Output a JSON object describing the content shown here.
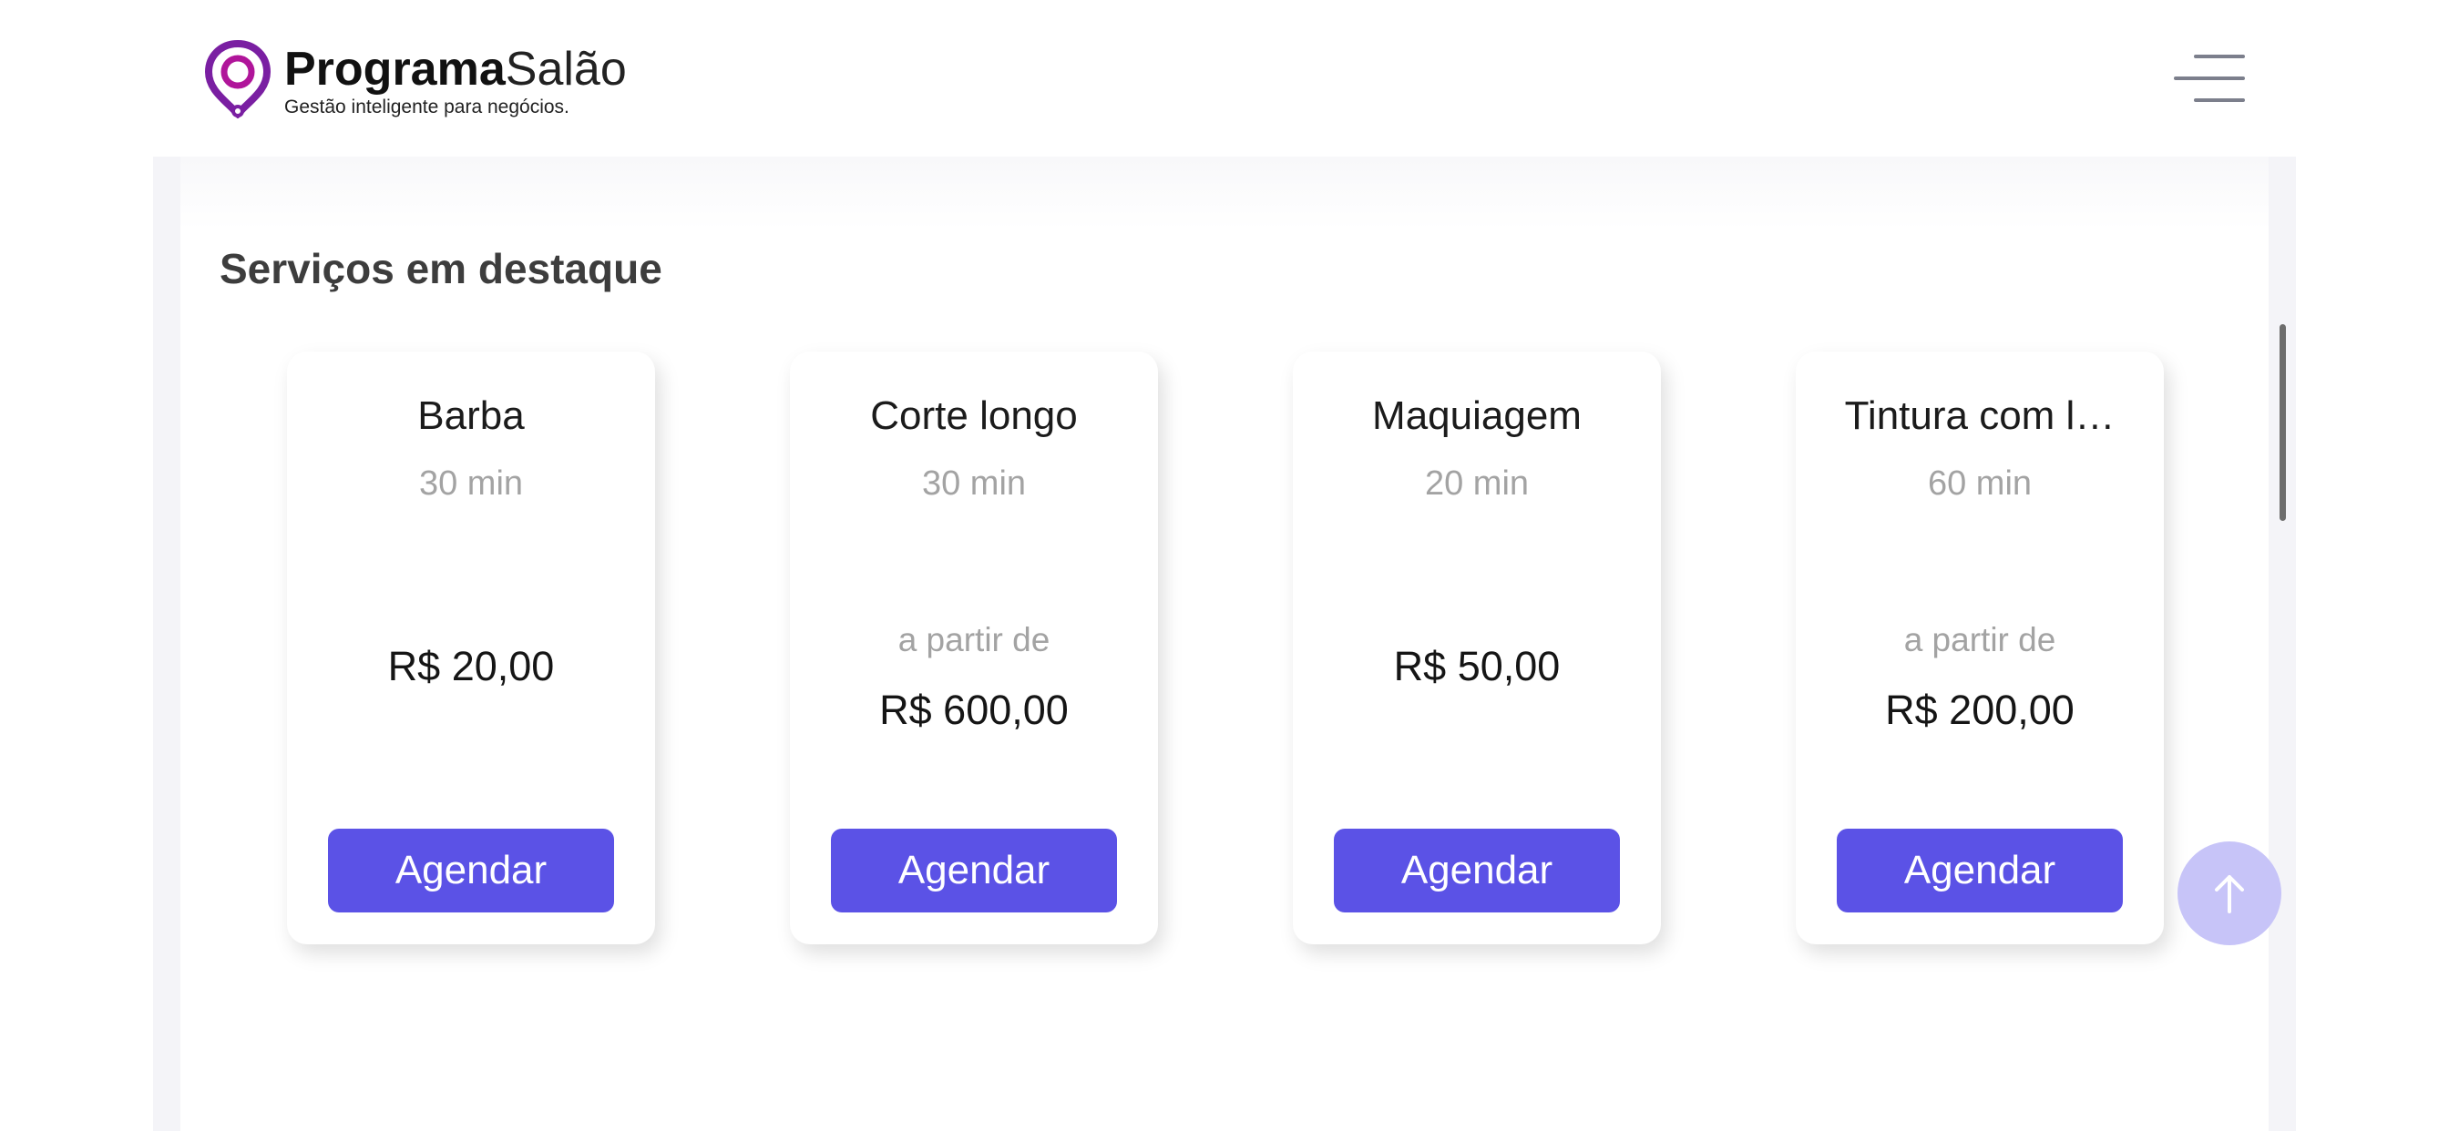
{
  "header": {
    "logo_bold": "Programa",
    "logo_light": "Salão",
    "tagline": "Gestão inteligente para negócios.",
    "brand_color": "#7a1fa2",
    "menu_icon": "hamburger-menu-icon"
  },
  "section": {
    "title": "Serviços em destaque"
  },
  "services": [
    {
      "name": "Barba",
      "duration": "30 min",
      "from_label": "",
      "price": "R$ 20,00",
      "button": "Agendar"
    },
    {
      "name": "Corte longo",
      "duration": "30 min",
      "from_label": "a partir de",
      "price": "R$ 600,00",
      "button": "Agendar"
    },
    {
      "name": "Maquiagem",
      "duration": "20 min",
      "from_label": "",
      "price": "R$ 50,00",
      "button": "Agendar"
    },
    {
      "name": "Tintura com l…",
      "duration": "60 min",
      "from_label": "a partir de",
      "price": "R$ 200,00",
      "button": "Agendar"
    }
  ],
  "colors": {
    "accent": "#5b52e6",
    "scroll_top_bg": "#c7c4f8"
  },
  "scroll_top_icon": "arrow-up-icon"
}
